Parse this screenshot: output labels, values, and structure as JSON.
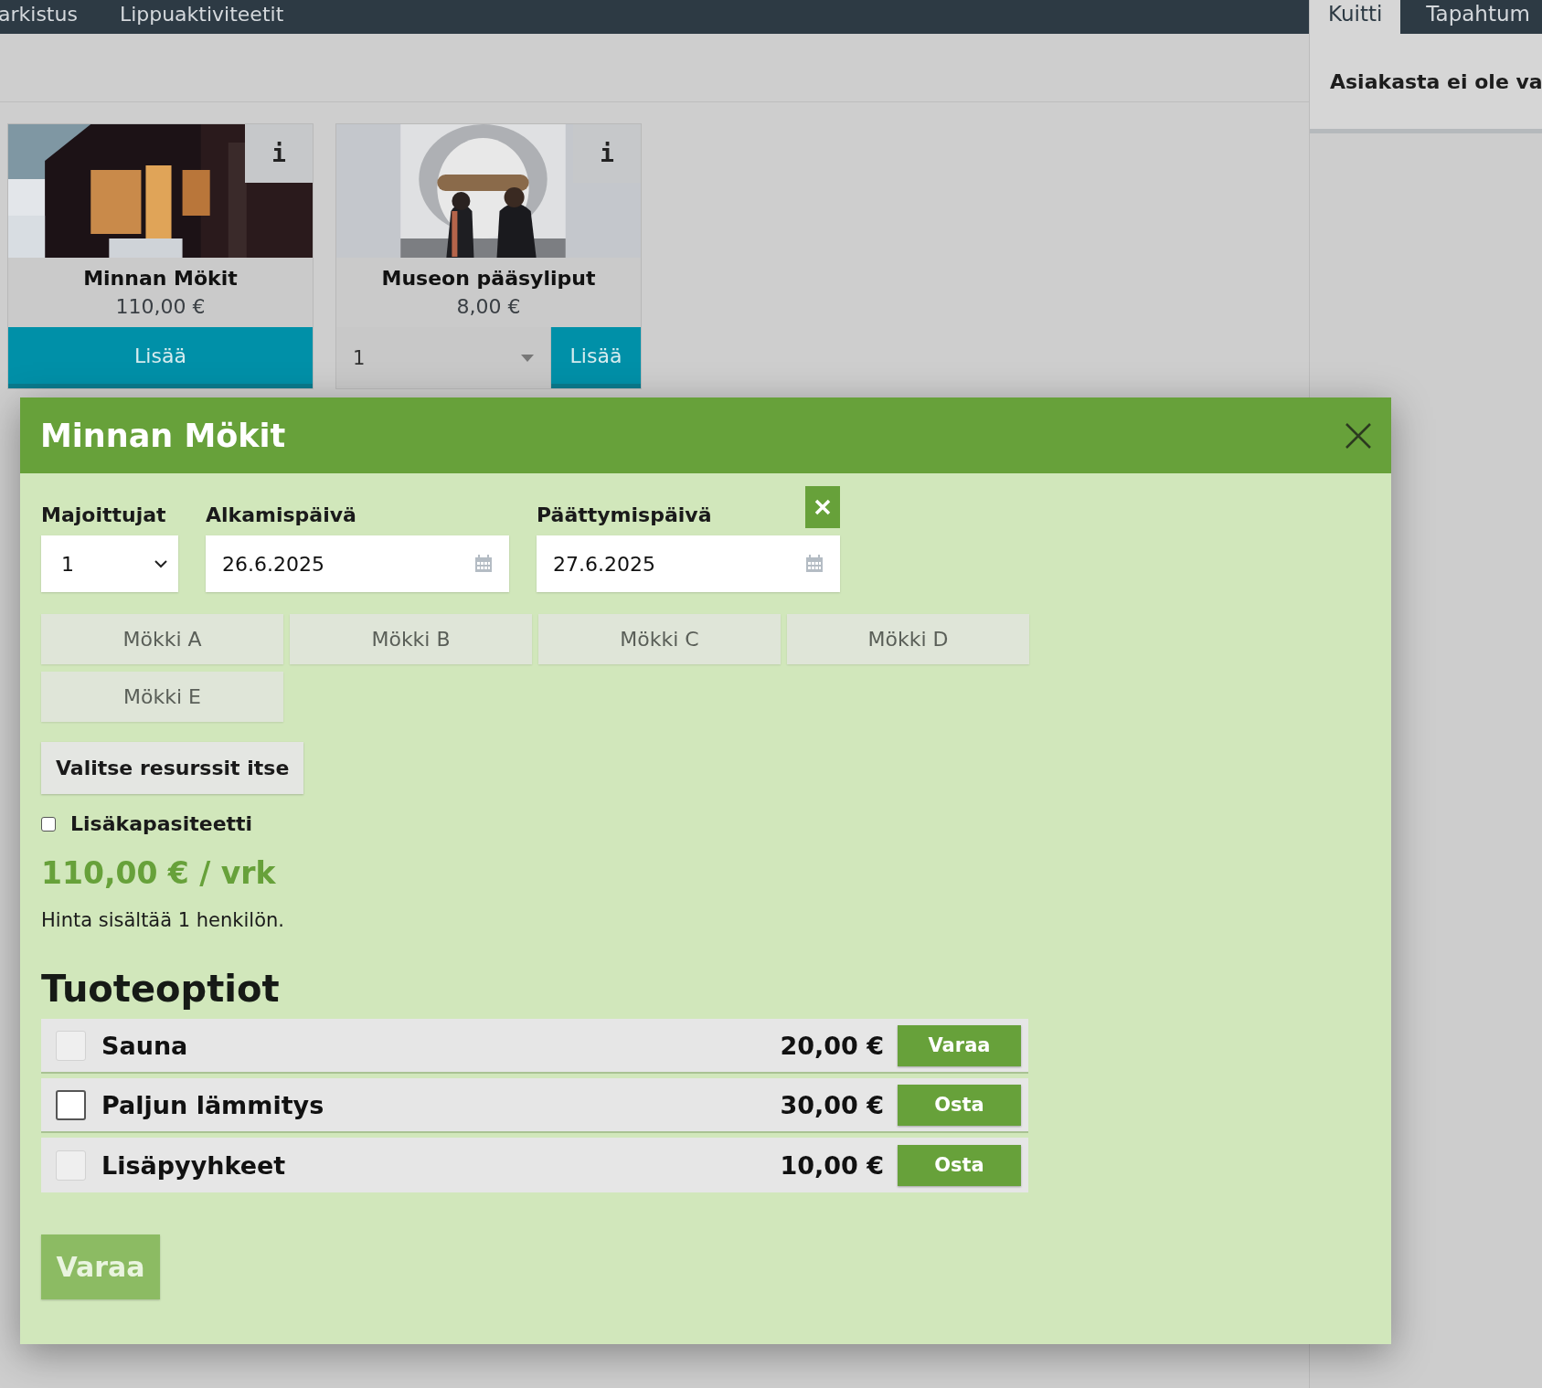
{
  "nav": {
    "items": [
      {
        "label": "arkistus"
      },
      {
        "label": "Lippuaktiviteetit"
      }
    ]
  },
  "side_panel": {
    "tabs": [
      {
        "label": "Kuitti",
        "selected": true
      },
      {
        "label": "Tapahtum",
        "selected": false
      }
    ],
    "customer_notice": "Asiakasta ei ole va"
  },
  "products": [
    {
      "name": "Minnan Mökit",
      "price": "110,00 €",
      "info_label": "i",
      "add_label": "Lisää"
    },
    {
      "name": "Museon pääsyliput",
      "price": "8,00 €",
      "info_label": "i",
      "add_label": "Lisää",
      "quantity": "1"
    }
  ],
  "modal": {
    "title": "Minnan Mökit",
    "fields": [
      {
        "kind": "select",
        "label": "Majoittujat",
        "value": "1"
      },
      {
        "kind": "date",
        "label": "Alkamispäivä",
        "value": "26.6.2025"
      },
      {
        "kind": "date",
        "label": "Päättymispäivä",
        "value": "27.6.2025",
        "clearable": true
      }
    ],
    "resources": [
      {
        "label": "Mökki A",
        "selected": false
      },
      {
        "label": "Mökki B",
        "selected": false
      },
      {
        "label": "Mökki C",
        "selected": false
      },
      {
        "label": "Mökki D",
        "selected": false
      },
      {
        "label": "Mökki E",
        "selected": false
      }
    ],
    "choose_button": "Valitse resurssit itse",
    "extra_capacity": {
      "label": "Lisäkapasiteetti",
      "checked": false
    },
    "price": "110,00 € / vrk",
    "price_note": "Hinta sisältää 1 henkilön.",
    "options_title": "Tuoteoptiot",
    "options": [
      {
        "name": "Sauna",
        "price": "20,00 €",
        "action": "Varaa",
        "checked": false,
        "disabled": true
      },
      {
        "name": "Paljun lämmitys",
        "price": "30,00 €",
        "action": "Osta",
        "checked": false,
        "disabled": false
      },
      {
        "name": "Lisäpyyhkeet",
        "price": "10,00 €",
        "action": "Osta",
        "checked": false,
        "disabled": true
      }
    ],
    "submit": {
      "label": "Varaa",
      "disabled": true
    }
  }
}
